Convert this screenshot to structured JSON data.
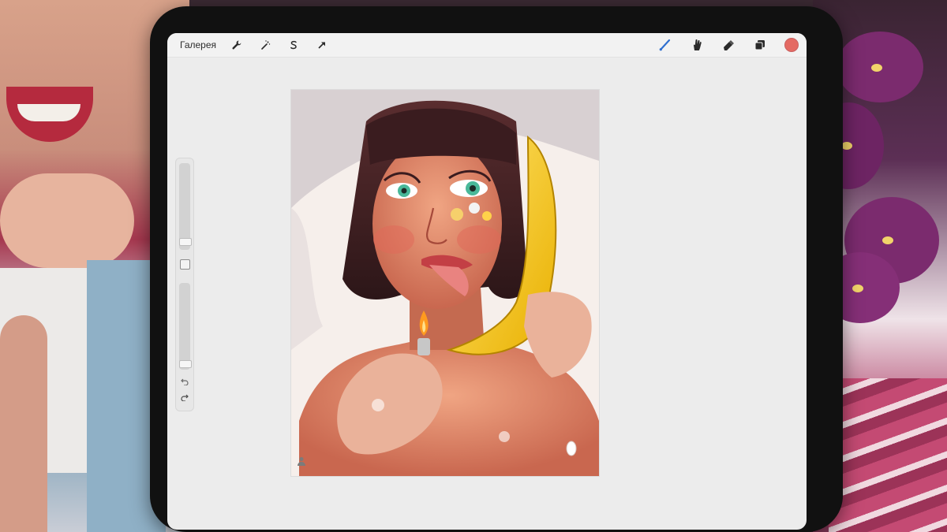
{
  "toolbar": {
    "gallery_label": "Галерея",
    "left_tools": [
      {
        "name": "actions",
        "icon": "wrench-icon"
      },
      {
        "name": "adjustments",
        "icon": "magic-wand-icon"
      },
      {
        "name": "selection",
        "icon": "selection-s-icon"
      },
      {
        "name": "transform",
        "icon": "arrow-cursor-icon"
      }
    ],
    "right_tools": [
      {
        "name": "brush",
        "icon": "brush-icon",
        "active": true
      },
      {
        "name": "smudge",
        "icon": "smudge-finger-icon"
      },
      {
        "name": "eraser",
        "icon": "eraser-icon"
      },
      {
        "name": "layers",
        "icon": "layers-icon"
      }
    ],
    "active_color": "#e46a63"
  },
  "sidebar": {
    "size_level": 0.05,
    "opacity_level": 0.02,
    "modify_icon": "square-icon",
    "undo_icon": "undo-arrow-icon",
    "redo_icon": "redo-arrow-icon"
  },
  "canvas": {
    "artwork": "illustration-portrait",
    "corner_icon": "person-icon"
  },
  "colors": {
    "brush_active": "#2f6fcf",
    "ui_icon": "#2a2a2a",
    "screen_bg": "#ececec"
  }
}
